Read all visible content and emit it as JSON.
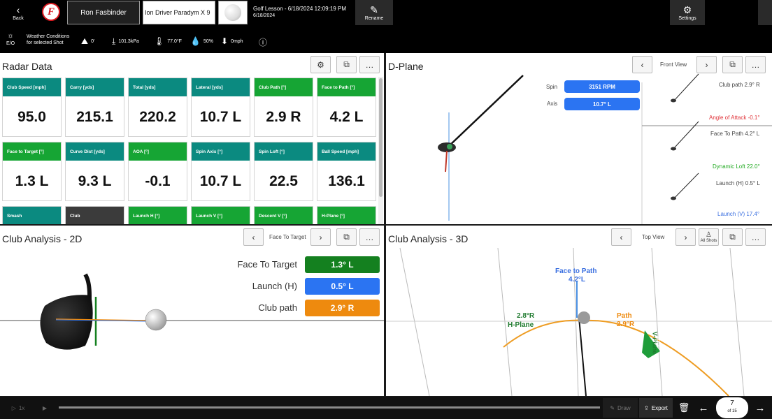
{
  "topbar": {
    "back_label": "Back",
    "player": "Ron Fasbinder",
    "club": "Ion Driver Paradym X 9",
    "session_title": "Golf Lesson - 6/18/2024 12:09:19 PM",
    "session_date": "6/18/2024",
    "rename_label": "Rename",
    "settings_label": "Settings"
  },
  "weather": {
    "icon_text": "E/O",
    "label_line1": "Weather Conditions",
    "label_line2": "for selected Shot",
    "altitude": "0'",
    "pressure": "101.3kPa",
    "temperature": "77.0°F",
    "humidity": "50%",
    "wind": "0mph"
  },
  "radar": {
    "title": "Radar Data",
    "tiles": [
      {
        "label": "Club Speed [mph]",
        "value": "95.0",
        "color": "teal"
      },
      {
        "label": "Carry [yds]",
        "value": "215.1",
        "color": "teal"
      },
      {
        "label": "Total [yds]",
        "value": "220.2",
        "color": "teal"
      },
      {
        "label": "Lateral [yds]",
        "value": "10.7 L",
        "color": "teal"
      },
      {
        "label": "Club Path [°]",
        "value": "2.9 R",
        "color": "green"
      },
      {
        "label": "Face to Path [°]",
        "value": "4.2 L",
        "color": "green"
      },
      {
        "label": "Face to Target [°]",
        "value": "1.3 L",
        "color": "green"
      },
      {
        "label": "Curve Dist [yds]",
        "value": "9.3 L",
        "color": "teal"
      },
      {
        "label": "AOA [°]",
        "value": "-0.1",
        "color": "green"
      },
      {
        "label": "Spin Axis [°]",
        "value": "10.7 L",
        "color": "teal"
      },
      {
        "label": "Spin Loft [°]",
        "value": "22.5",
        "color": "teal"
      },
      {
        "label": "Ball Speed [mph]",
        "value": "136.1",
        "color": "teal"
      },
      {
        "label": "Smash",
        "value": "",
        "color": "teal"
      },
      {
        "label": "Club",
        "value": "",
        "color": "dark"
      },
      {
        "label": "Launch H [°]",
        "value": "",
        "color": "green"
      },
      {
        "label": "Launch V [°]",
        "value": "",
        "color": "green"
      },
      {
        "label": "Descent V [°]",
        "value": "",
        "color": "green"
      },
      {
        "label": "H-Plane [°]",
        "value": "",
        "color": "green"
      }
    ]
  },
  "dplane": {
    "title": "D-Plane",
    "view_label": "Front View",
    "spin_label": "Spin",
    "spin_value": "3151 RPM",
    "axis_label": "Axis",
    "axis_value": "10.7° L",
    "club_path": "Club path  2.9° R",
    "angle_of_attack": "Angle of Attack  -0.1°",
    "face_to_path": "Face To Path  4.2° L",
    "dynamic_loft": "Dynamic Loft  22.0°",
    "launch_h": "Launch (H)  0.5° L",
    "launch_v": "Launch (V)  17.4°"
  },
  "club2d": {
    "title": "Club Analysis - 2D",
    "view_label": "Face To Target",
    "metrics": [
      {
        "label": "Face To Target",
        "value": "1.3° L",
        "color": "#14801f"
      },
      {
        "label": "Launch (H)",
        "value": "0.5° L",
        "color": "#2b74f2"
      },
      {
        "label": "Club path",
        "value": "2.9° R",
        "color": "#ee8a0e"
      }
    ]
  },
  "club3d": {
    "title": "Club Analysis - 3D",
    "view_label": "Top View",
    "all_shots_label": "All Shots",
    "face_to_path_label": "Face to Path",
    "face_to_path_value": "4.2°L",
    "hplane_value": "2.8°R",
    "hplane_label": "H-Plane",
    "path_label": "Path",
    "path_value": "2.9°R",
    "vplane_label": "V-Plane",
    "vplane_value": "49.7"
  },
  "bottom": {
    "speed_label": "1x",
    "draw_label": "Draw",
    "export_label": "Export",
    "page_current": "7",
    "page_total": "of 15"
  }
}
